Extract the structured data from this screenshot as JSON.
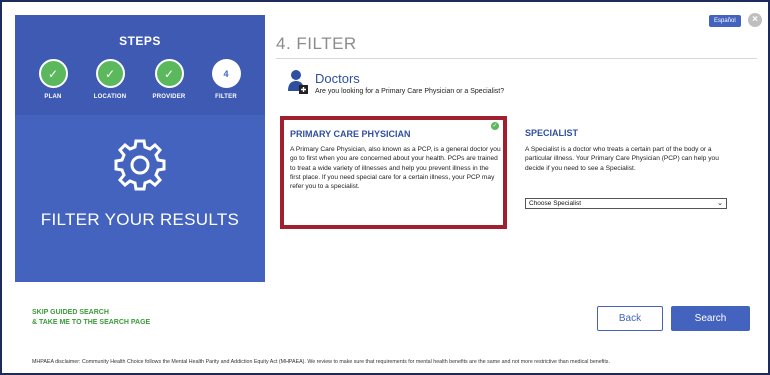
{
  "steps": {
    "title": "STEPS",
    "items": [
      {
        "label": "PLAN",
        "status": "done",
        "icon": "check-icon"
      },
      {
        "label": "LOCATION",
        "status": "done",
        "icon": "check-icon"
      },
      {
        "label": "PROVIDER",
        "status": "done",
        "icon": "check-icon"
      },
      {
        "label": "FILTER",
        "status": "current",
        "number": "4"
      }
    ],
    "panel_caption": "FILTER YOUR RESULTS",
    "icon": "gear-icon"
  },
  "header": {
    "language_label": "Español",
    "close_icon": "close-icon",
    "title": "4. FILTER"
  },
  "doctors": {
    "icon": "doctor-icon",
    "title": "Doctors",
    "subtitle": "Are you looking for a Primary Care Physician or a Specialist?"
  },
  "pcp": {
    "title": "PRIMARY CARE PHYSICIAN",
    "body": "A Primary Care Physician, also known as a PCP, is a general doctor you go to first when you are concerned about your health. PCPs are trained to treat a wide variety of illnesses and help you prevent illness in the first place. If you need special care for a certain illness, your PCP may refer you to a specialist.",
    "selected": true
  },
  "specialist": {
    "title": "SPECIALIST",
    "body": "A Specialist is a doctor who treats a certain part of the body or a particular illness. Your Primary Care Physician (PCP) can help you decide if you need to see a Specialist.",
    "select_value": "Choose Specialist"
  },
  "footer": {
    "skip_line1": "SKIP GUIDED SEARCH",
    "skip_line2": "& TAKE ME TO THE SEARCH PAGE",
    "back_label": "Back",
    "search_label": "Search",
    "disclaimer": "MHPAEA disclaimer: Community Health Choice follows the Mental Health Parity and Addiction Equity Act (MHPAEA). We review to make sure that requirements for mental health benefits are the same and not more restrictive than medical benefits."
  },
  "colors": {
    "primary": "#4463bf",
    "success": "#5cb85c",
    "selected_border": "#a02030",
    "link_green": "#3b9b3b"
  }
}
